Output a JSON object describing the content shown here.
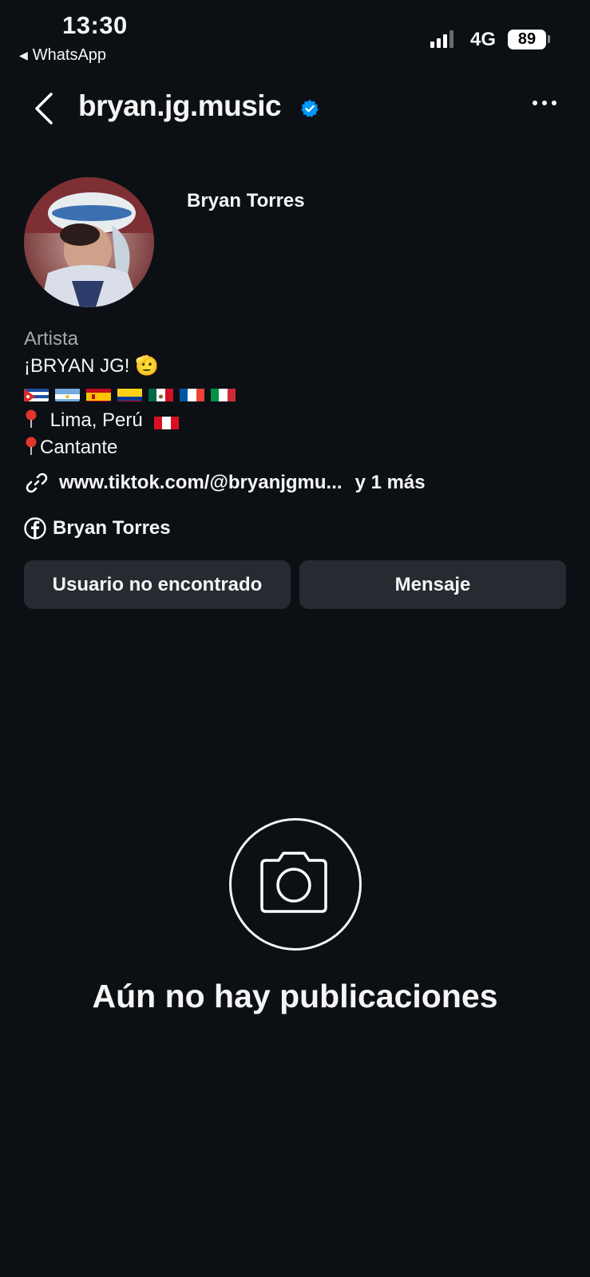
{
  "status_bar": {
    "time": "13:30",
    "back_app": "WhatsApp",
    "network": "4G",
    "battery": "89"
  },
  "header": {
    "username": "bryan.jg.music"
  },
  "profile": {
    "display_name": "Bryan Torres",
    "category": "Artista",
    "bio_line1": "¡BRYAN JG! 🫡",
    "location": "Lima, Perú",
    "occupation": "Cantante",
    "link_text": "www.tiktok.com/@bryanjgmu...",
    "link_more": "y 1 más",
    "facebook_name": "Bryan Torres"
  },
  "flags": [
    "Cuba",
    "Argentina",
    "España",
    "Colombia",
    "México",
    "Francia",
    "Italia"
  ],
  "buttons": {
    "user_not_found": "Usuario no encontrado",
    "message": "Mensaje"
  },
  "empty_state": {
    "text": "Aún no hay publicaciones"
  },
  "colors": {
    "background": "#0c1014",
    "button": "#262a31",
    "verified": "#0095f6",
    "muted": "#a8a8a8"
  }
}
